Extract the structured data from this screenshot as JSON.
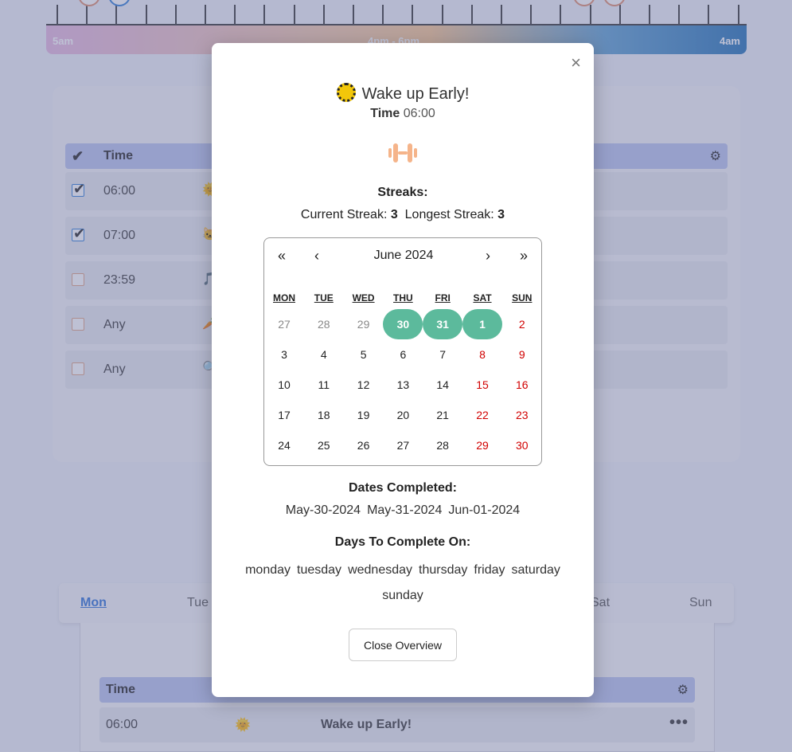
{
  "timeline": {
    "labels": {
      "start": "5am",
      "middle": "4pm - 6pm",
      "end": "4am"
    }
  },
  "habits_table": {
    "header_time": "Time",
    "rows": [
      {
        "checked": true,
        "time": "06:00"
      },
      {
        "checked": true,
        "time": "07:00"
      },
      {
        "checked": false,
        "time": "23:59"
      },
      {
        "checked": false,
        "time": "Any"
      },
      {
        "checked": false,
        "time": "Any"
      }
    ]
  },
  "week_tabs": [
    "Mon",
    "Tue",
    "Sat",
    "Sun"
  ],
  "day_table": {
    "header_time": "Time",
    "row": {
      "time": "06:00",
      "name": "Wake up Early!"
    }
  },
  "modal": {
    "close_symbol": "×",
    "title": "Wake up Early!",
    "time_label": "Time",
    "time_value": "06:00",
    "streaks_label": "Streaks:",
    "current_streak_label": "Current Streak:",
    "current_streak": "3",
    "longest_streak_label": "Longest Streak:",
    "longest_streak": "3",
    "calendar": {
      "nav_prev_year": "«",
      "nav_prev_month": "‹",
      "month": "June 2024",
      "nav_next_month": "›",
      "nav_next_year": "»",
      "weekdays": [
        "MON",
        "TUE",
        "WED",
        "THU",
        "FRI",
        "SAT",
        "SUN"
      ],
      "weeks": [
        [
          "27",
          "28",
          "29",
          "30",
          "31",
          "1",
          "2"
        ],
        [
          "3",
          "4",
          "5",
          "6",
          "7",
          "8",
          "9"
        ],
        [
          "10",
          "11",
          "12",
          "13",
          "14",
          "15",
          "16"
        ],
        [
          "17",
          "18",
          "19",
          "20",
          "21",
          "22",
          "23"
        ],
        [
          "24",
          "25",
          "26",
          "27",
          "28",
          "29",
          "30"
        ]
      ],
      "other_month_prefix_days": 5,
      "completed_cells": [
        [
          0,
          3
        ],
        [
          0,
          4
        ],
        [
          0,
          5
        ]
      ],
      "completed_color": "#5cba9c",
      "weekend_color": "#d10000"
    },
    "dates_completed_label": "Dates Completed:",
    "dates_completed": [
      "May-30-2024",
      "May-31-2024",
      "Jun-01-2024"
    ],
    "days_label": "Days To Complete On:",
    "days": [
      "monday",
      "tuesday",
      "wednesday",
      "thursday",
      "friday",
      "saturday",
      "sunday"
    ],
    "close_button": "Close Overview"
  }
}
